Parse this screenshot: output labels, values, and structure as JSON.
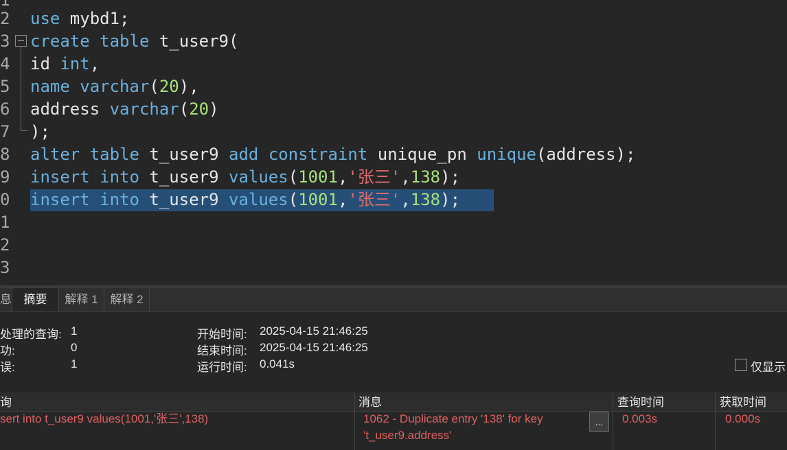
{
  "editor": {
    "line_numbers": [
      "1",
      "2",
      "3",
      "4",
      "5",
      "6",
      "7",
      "8",
      "9",
      "0",
      "1",
      "2",
      "3"
    ],
    "lines": [
      {
        "tokens": []
      },
      {
        "tokens": [
          {
            "t": "kw",
            "v": "use"
          },
          {
            "t": "tx",
            "v": " mybd1;"
          }
        ]
      },
      {
        "tokens": [
          {
            "t": "kw",
            "v": "create"
          },
          {
            "t": "tx",
            "v": " "
          },
          {
            "t": "kw",
            "v": "table"
          },
          {
            "t": "tx",
            "v": " t_user9("
          }
        ]
      },
      {
        "indent": true,
        "tokens": [
          {
            "t": "tx",
            "v": "id "
          },
          {
            "t": "kw",
            "v": "int"
          },
          {
            "t": "tx",
            "v": ","
          }
        ]
      },
      {
        "indent": true,
        "tokens": [
          {
            "t": "kw",
            "v": "name"
          },
          {
            "t": "tx",
            "v": " "
          },
          {
            "t": "kw",
            "v": "varchar"
          },
          {
            "t": "tx",
            "v": "("
          },
          {
            "t": "num",
            "v": "20"
          },
          {
            "t": "tx",
            "v": "),"
          }
        ]
      },
      {
        "indent": true,
        "tokens": [
          {
            "t": "tx",
            "v": "address "
          },
          {
            "t": "kw",
            "v": "varchar"
          },
          {
            "t": "tx",
            "v": "("
          },
          {
            "t": "num",
            "v": "20"
          },
          {
            "t": "tx",
            "v": ")"
          }
        ]
      },
      {
        "indent": true,
        "tokens": [
          {
            "t": "tx",
            "v": ");"
          }
        ]
      },
      {
        "tokens": [
          {
            "t": "kw",
            "v": "alter"
          },
          {
            "t": "tx",
            "v": " "
          },
          {
            "t": "kw",
            "v": "table"
          },
          {
            "t": "tx",
            "v": " t_user9 "
          },
          {
            "t": "kw",
            "v": "add"
          },
          {
            "t": "tx",
            "v": " "
          },
          {
            "t": "kw",
            "v": "constraint"
          },
          {
            "t": "tx",
            "v": " unique_pn "
          },
          {
            "t": "kw",
            "v": "unique"
          },
          {
            "t": "tx",
            "v": "(address);"
          }
        ]
      },
      {
        "tokens": [
          {
            "t": "kw",
            "v": "insert"
          },
          {
            "t": "tx",
            "v": " "
          },
          {
            "t": "kw",
            "v": "into"
          },
          {
            "t": "tx",
            "v": " t_user9 "
          },
          {
            "t": "kw",
            "v": "values"
          },
          {
            "t": "tx",
            "v": "("
          },
          {
            "t": "num",
            "v": "1001"
          },
          {
            "t": "tx",
            "v": ","
          },
          {
            "t": "str",
            "v": "'张三'"
          },
          {
            "t": "tx",
            "v": ","
          },
          {
            "t": "num",
            "v": "138"
          },
          {
            "t": "tx",
            "v": ");"
          }
        ]
      },
      {
        "selected": true,
        "tokens": [
          {
            "t": "kw",
            "v": "insert"
          },
          {
            "t": "tx",
            "v": " "
          },
          {
            "t": "kw",
            "v": "into"
          },
          {
            "t": "tx",
            "v": " t_user9 "
          },
          {
            "t": "kw",
            "v": "values"
          },
          {
            "t": "tx",
            "v": "("
          },
          {
            "t": "num",
            "v": "1001"
          },
          {
            "t": "tx",
            "v": ","
          },
          {
            "t": "str",
            "v": "'张三'"
          },
          {
            "t": "tx",
            "v": ","
          },
          {
            "t": "num",
            "v": "138"
          },
          {
            "t": "tx",
            "v": ");"
          }
        ]
      },
      {
        "tokens": []
      },
      {
        "tokens": []
      },
      {
        "tokens": []
      }
    ]
  },
  "tabs": {
    "partial": "息",
    "summary": "摘要",
    "explain1": "解释 1",
    "explain2": "解释 2"
  },
  "summary": {
    "processed_label": "处理的查询:",
    "processed_value": "1",
    "success_label": "功:",
    "success_value": "0",
    "error_label": "误:",
    "error_value": "1",
    "start_label": "开始时间:",
    "start_value": "2025-04-15 21:46:25",
    "end_label": "结束时间:",
    "end_value": "2025-04-15 21:46:25",
    "run_label": "运行时间:",
    "run_value": "0.041s",
    "only_show_label": "仅显示"
  },
  "result_table": {
    "headers": {
      "query": "询",
      "message": "消息",
      "query_time": "查询时间",
      "fetch_time": "获取时间"
    },
    "row": {
      "query": "sert into t_user9 values(1001,'张三',138)",
      "message_line1": "1062 - Duplicate entry '138' for key",
      "message_line2": "'t_user9.address'",
      "query_time": "0.003s",
      "fetch_time": "0.000s"
    },
    "more_button": "..."
  },
  "colors": {
    "keyword": "#6ab0de",
    "number": "#a8e27a",
    "string": "#e36b6b",
    "selection": "#264f78",
    "error_text": "#e06060"
  }
}
